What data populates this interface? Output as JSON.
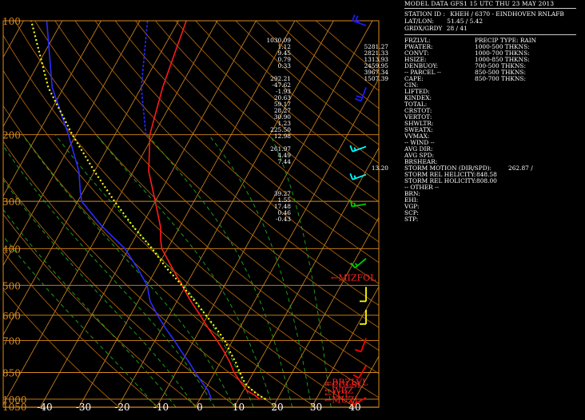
{
  "header": {
    "title": "MODEL DATA GFS1 15 UTC THU 23 MAY 2013",
    "station_label": "STATION ID :",
    "station_value": "KHEH / 6370  - EINDHOVEN RNLAFB",
    "latlon_label": "LAT/LON:",
    "latlon_value": "51.45 /      5.42",
    "grdx_label": "GRDX/GRDY",
    "grdx_value": "28 /    41"
  },
  "indices": [
    {
      "k": "FRZLVL:",
      "v": "1030.09",
      "k2": "PRECIP TYPE: RAIN",
      "v2": ""
    },
    {
      "k": "PWATER:",
      "v": "1.12",
      "k2": "1000-500 THKNS:",
      "v2": "5281.27"
    },
    {
      "k": "CONVT:",
      "v": "9.45",
      "k2": "1000-700 THKNS:",
      "v2": "2821.33"
    },
    {
      "k": "HSIZE:",
      "v": "0.79",
      "k2": "1000-850 THKNS:",
      "v2": "1313.93"
    },
    {
      "k": "DENBUOY:",
      "v": "0.33",
      "k2": "700-500  THKNS:",
      "v2": "2459.95"
    },
    {
      "k": "-- PARCEL --",
      "v": "",
      "k2": "850-500  THKNS:",
      "v2": "3967.34"
    },
    {
      "k": "CAPE:",
      "v": "292.21",
      "k2": "850-700  THKNS:",
      "v2": "1507.39"
    },
    {
      "k": "CIN:",
      "v": "-47.62",
      "k2": "",
      "v2": ""
    },
    {
      "k": "LIFTED:",
      "v": "-1.93",
      "k2": "",
      "v2": ""
    },
    {
      "k": "KINDEX:",
      "v": "20.63",
      "k2": "",
      "v2": ""
    },
    {
      "k": "TOTAL:",
      "v": "59.17",
      "k2": "",
      "v2": ""
    },
    {
      "k": "CRSTOT:",
      "v": "28.27",
      "k2": "",
      "v2": ""
    },
    {
      "k": "VERTOT:",
      "v": "30.90",
      "k2": "",
      "v2": ""
    },
    {
      "k": "SHWLTR:",
      "v": "1.23",
      "k2": "",
      "v2": ""
    },
    {
      "k": "SWEATX:",
      "v": "225.50",
      "k2": "",
      "v2": ""
    },
    {
      "k": "VVMAX:",
      "v": "12.98",
      "k2": "",
      "v2": ""
    },
    {
      "k": "-- WIND --",
      "v": "",
      "k2": "",
      "v2": ""
    },
    {
      "k": "AVG DIR:",
      "v": "261.97",
      "k2": "",
      "v2": ""
    },
    {
      "k": "AVG SPD:",
      "v": "4.49",
      "k2": "",
      "v2": ""
    },
    {
      "k": "BRSHEAR:",
      "v": "7.44",
      "k2": "",
      "v2": ""
    },
    {
      "k": "STORM MOTION (DIR/SPD):",
      "v": "",
      "k2": "262.87 /",
      "v2": "13.20"
    },
    {
      "k": "STORM REL HELICITY:",
      "v": "",
      "k2": "848.58",
      "v2": ""
    },
    {
      "k": "STORM REL HOLICITY:",
      "v": "",
      "k2": "808.00",
      "v2": ""
    },
    {
      "k": "-- OTHER --",
      "v": "",
      "k2": "",
      "v2": ""
    },
    {
      "k": "BRN:",
      "v": "39.27",
      "k2": "",
      "v2": ""
    },
    {
      "k": "EHI:",
      "v": "1.55",
      "k2": "",
      "v2": ""
    },
    {
      "k": "VGP:",
      "v": "17.48",
      "k2": "",
      "v2": ""
    },
    {
      "k": "SCP:",
      "v": "0.46",
      "k2": "",
      "v2": ""
    },
    {
      "k": "STP:",
      "v": "-0.43",
      "k2": "",
      "v2": ""
    }
  ],
  "chart_data": {
    "type": "line",
    "chart_kind": "skew-T log-p",
    "x_unit": "deg C",
    "y_unit": "hPa",
    "y_scale": "log",
    "y_reversed": true,
    "xlim": [
      -50,
      50
    ],
    "ylim": [
      1050,
      100
    ],
    "x_ticks": [
      -40,
      -30,
      -20,
      -10,
      0,
      10,
      20,
      30,
      40
    ],
    "y_ticks": [
      100,
      200,
      300,
      400,
      500,
      600,
      700,
      850,
      1000
    ],
    "y_tick_labels": [
      "100",
      "200",
      "300",
      "400",
      "500",
      "600",
      "700",
      "850",
      "1000"
    ],
    "bottom_label": "1050",
    "isotherm_step": 10,
    "dry_adiabat_thetas_k": [
      250,
      260,
      270,
      280,
      290,
      300,
      310,
      320,
      330,
      340,
      350,
      360,
      370,
      380,
      390,
      400,
      410,
      420,
      430,
      440,
      450,
      460,
      470,
      480
    ],
    "moist_adiabat_start_c": [
      -10,
      -5,
      0,
      5,
      10,
      15,
      20,
      25,
      30,
      35
    ],
    "series": [
      {
        "role": "temperature",
        "color": "#ff1a1a",
        "points": [
          [
            1000,
            15.5
          ],
          [
            975,
            13.5
          ],
          [
            950,
            11.0
          ],
          [
            925,
            9.5
          ],
          [
            900,
            8.0
          ],
          [
            850,
            5.0
          ],
          [
            800,
            2.5
          ],
          [
            750,
            -0.5
          ],
          [
            700,
            -4.0
          ],
          [
            650,
            -8.0
          ],
          [
            600,
            -12.0
          ],
          [
            550,
            -16.5
          ],
          [
            500,
            -21.0
          ],
          [
            450,
            -26.0
          ],
          [
            400,
            -31.5
          ],
          [
            380,
            -33.0
          ],
          [
            350,
            -35.0
          ],
          [
            300,
            -40.0
          ],
          [
            250,
            -46.0
          ],
          [
            200,
            -51.0
          ],
          [
            150,
            -54.5
          ],
          [
            100,
            -58.0
          ]
        ]
      },
      {
        "role": "dewpoint",
        "color": "#2a2aff",
        "points": [
          [
            1000,
            3.0
          ],
          [
            950,
            1.0
          ],
          [
            900,
            -2.0
          ],
          [
            850,
            -5.0
          ],
          [
            800,
            -8.0
          ],
          [
            750,
            -11.5
          ],
          [
            700,
            -15.0
          ],
          [
            650,
            -19.0
          ],
          [
            600,
            -23.0
          ],
          [
            550,
            -27.0
          ],
          [
            500,
            -30.0
          ],
          [
            450,
            -35.0
          ],
          [
            400,
            -41.0
          ],
          [
            350,
            -50.0
          ],
          [
            300,
            -59.0
          ],
          [
            280,
            -61.0
          ],
          [
            250,
            -64.0
          ],
          [
            200,
            -72.0
          ],
          [
            150,
            -83.0
          ],
          [
            100,
            -94.0
          ]
        ]
      },
      {
        "role": "dewpoint-upper",
        "color": "#2a2aff",
        "dashed": true,
        "points": [
          [
            200,
            -52.0
          ],
          [
            150,
            -60.0
          ],
          [
            100,
            -68.0
          ]
        ]
      },
      {
        "role": "parcel",
        "color": "#ffff00",
        "dashed": true,
        "points": [
          [
            1000,
            17.0
          ],
          [
            975,
            14.5
          ],
          [
            950,
            12.5
          ],
          [
            925,
            10.5
          ],
          [
            900,
            9.0
          ],
          [
            850,
            6.5
          ],
          [
            800,
            4.0
          ],
          [
            750,
            1.0
          ],
          [
            700,
            -2.0
          ],
          [
            650,
            -6.0
          ],
          [
            600,
            -10.5
          ],
          [
            550,
            -15.5
          ],
          [
            500,
            -21.0
          ],
          [
            450,
            -27.5
          ],
          [
            400,
            -34.0
          ],
          [
            350,
            -42.0
          ],
          [
            300,
            -50.5
          ],
          [
            250,
            -60.0
          ],
          [
            200,
            -71.0
          ],
          [
            150,
            -84.0
          ],
          [
            100,
            -98.0
          ]
        ]
      }
    ],
    "level_labels": [
      {
        "text": "MIZFOL",
        "p": 477,
        "t": 23.0
      },
      {
        "text": "BRZLVL",
        "p": 901,
        "t": 34.5
      },
      {
        "text": "CCLSL",
        "p": 915,
        "t": 34.0
      },
      {
        "text": "WBZ",
        "p": 945,
        "t": 33.5
      },
      {
        "text": "LCL",
        "p": 968,
        "t": 34.5
      },
      {
        "text": "MUZL",
        "p": 1003,
        "t": 35.5
      }
    ],
    "wind_barbs": [
      {
        "p": 103,
        "dir": 290,
        "spd": 25,
        "color": "#1a1aff"
      },
      {
        "p": 150,
        "dir": 200,
        "spd": 20,
        "color": "#1a1aff"
      },
      {
        "p": 215,
        "dir": 250,
        "spd": 15,
        "color": "#00ffff"
      },
      {
        "p": 255,
        "dir": 250,
        "spd": 15,
        "color": "#00ffff"
      },
      {
        "p": 305,
        "dir": 260,
        "spd": 15,
        "color": "#00cc00"
      },
      {
        "p": 425,
        "dir": 230,
        "spd": 15,
        "color": "#00cc00"
      },
      {
        "p": 505,
        "dir": 180,
        "spd": 10,
        "color": "#ffff00"
      },
      {
        "p": 580,
        "dir": 180,
        "spd": 10,
        "color": "#ffff00"
      },
      {
        "p": 690,
        "dir": 200,
        "spd": 10,
        "color": "#ff0000"
      },
      {
        "p": 815,
        "dir": 210,
        "spd": 10,
        "color": "#ff0000"
      },
      {
        "p": 990,
        "dir": 240,
        "spd": 10,
        "color": "#ff0000"
      }
    ]
  }
}
